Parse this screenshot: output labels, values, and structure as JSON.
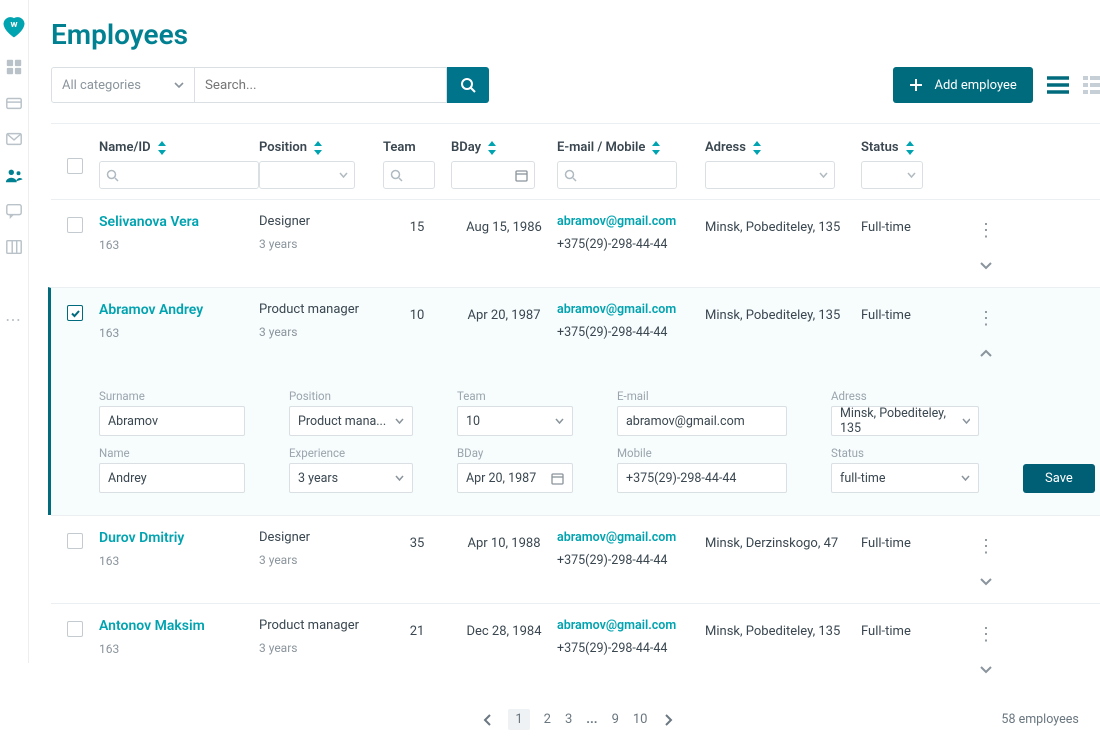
{
  "page": {
    "title": "Employees",
    "category_placeholder": "All categories",
    "search_placeholder": "Search...",
    "add_btn": "Add employee"
  },
  "columns": {
    "name": "Name/ID",
    "position": "Position",
    "team": "Team",
    "bday": "BDay",
    "email": "E-mail / Mobile",
    "address": "Adress",
    "status": "Status"
  },
  "rows": [
    {
      "name": "Selivanova Vera",
      "id": "163",
      "position": "Designer",
      "exp": "3 years",
      "team": "15",
      "bday": "Aug 15, 1986",
      "email": "abramov@gmail.com",
      "mobile": "+375(29)-298-44-44",
      "address": "Minsk, Pobediteley, 135",
      "status": "Full-time"
    },
    {
      "name": "Abramov Andrey",
      "id": "163",
      "position": "Product manager",
      "exp": "3 years",
      "team": "10",
      "bday": "Apr 20, 1987",
      "email": "abramov@gmail.com",
      "mobile": "+375(29)-298-44-44",
      "address": "Minsk, Pobediteley, 135",
      "status": "Full-time"
    },
    {
      "name": "Durov Dmitriy",
      "id": "163",
      "position": "Designer",
      "exp": "3 years",
      "team": "35",
      "bday": "Apr 10, 1988",
      "email": "abramov@gmail.com",
      "mobile": "+375(29)-298-44-44",
      "address": "Minsk, Derzinskogo, 47",
      "status": "Full-time"
    },
    {
      "name": "Antonov Maksim",
      "id": "163",
      "position": "Product manager",
      "exp": "3 years",
      "team": "21",
      "bday": "Dec 28, 1984",
      "email": "abramov@gmail.com",
      "mobile": "+375(29)-298-44-44",
      "address": "Minsk, Pobediteley, 135",
      "status": "Full-time"
    }
  ],
  "details": {
    "labels": {
      "surname": "Surname",
      "name": "Name",
      "position": "Position",
      "experience": "Experience",
      "team": "Team",
      "bday": "BDay",
      "email": "E-mail",
      "mobile": "Mobile",
      "address": "Adress",
      "status": "Status"
    },
    "values": {
      "surname": "Abramov",
      "name": "Andrey",
      "position": "Product mana...",
      "experience": "3 years",
      "team": "10",
      "bday": "Apr 20, 1987",
      "email": "abramov@gmail.com",
      "mobile": "+375(29)-298-44-44",
      "address": "Minsk, Pobediteley, 135",
      "status": "full-time"
    },
    "save": "Save"
  },
  "pager": {
    "pages": [
      "1",
      "2",
      "3",
      "...",
      "9",
      "10"
    ],
    "total": "58 employees"
  }
}
